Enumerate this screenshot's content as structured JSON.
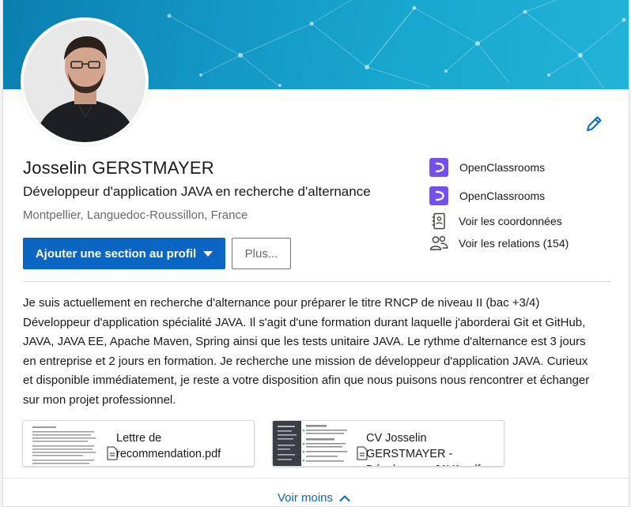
{
  "profile": {
    "name": "Josselin GERSTMAYER",
    "headline": "Développeur d'application JAVA en recherche d'alternance",
    "location": "Montpellier, Languedoc-Roussillon, France"
  },
  "actions": {
    "add_section_label": "Ajouter une section au profil",
    "more_label": "Plus..."
  },
  "sidebar": {
    "items": [
      {
        "label": "OpenClassrooms",
        "icon": "openclassrooms-logo"
      },
      {
        "label": "OpenClassrooms",
        "icon": "openclassrooms-logo"
      },
      {
        "label": "Voir les coordonnées",
        "icon": "contact-card-icon"
      },
      {
        "label": "Voir les relations (154)",
        "icon": "people-icon"
      }
    ]
  },
  "summary": {
    "text": "Je suis actuellement en recherche d'alternance pour préparer le titre RNCP de niveau II (bac +3/4) Développeur d'application spécialité JAVA. Il s'agit d'une formation durant laquelle j'aborderai Git et GitHub, JAVA, JAVA EE, Apache Maven, Spring ainsi que les tests unitaire JAVA. Le rythme d'alternance est 3 jours en entreprise et 2 jours en formation. Je recherche une mission de développeur d'application JAVA. Curieux et disponible immédiatement, je reste a votre disposition afin que nous puisons nous rencontrer et échanger sur mon projet professionnel."
  },
  "documents": [
    {
      "title": "Lettre de recommendation.pdf",
      "icon": "document-icon"
    },
    {
      "title": "CV Josselin GERSTMAYER - Développeur JAVA.pdf",
      "icon": "document-icon"
    }
  ],
  "footer": {
    "see_less_label": "Voir moins",
    "icon": "chevron-up-icon"
  },
  "colors": {
    "primary": "#0a66c2",
    "banner": "#1497c6",
    "openclassrooms": "#7451eb"
  }
}
